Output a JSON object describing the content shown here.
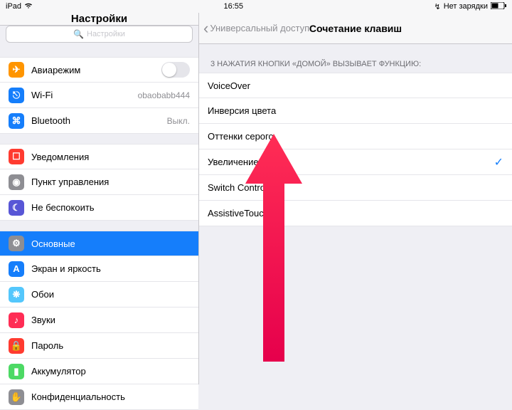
{
  "status": {
    "device": "iPad",
    "time": "16:55",
    "charging": "Нет зарядки"
  },
  "left": {
    "title": "Настройки",
    "search_placeholder": "Настройки",
    "groups": [
      {
        "rows": [
          {
            "id": "airplane",
            "icon_bg": "#ff9500",
            "glyph": "✈",
            "label": "Авиарежим",
            "type": "toggle"
          },
          {
            "id": "wifi",
            "icon_bg": "#157efb",
            "glyph": "⎋",
            "label": "Wi-Fi",
            "detail": "obaobabb444"
          },
          {
            "id": "bluetooth",
            "icon_bg": "#157efb",
            "glyph": "⌘",
            "label": "Bluetooth",
            "detail": "Выкл."
          }
        ]
      },
      {
        "rows": [
          {
            "id": "notifications",
            "icon_bg": "#ff3b30",
            "glyph": "☐",
            "label": "Уведомления"
          },
          {
            "id": "controlcenter",
            "icon_bg": "#8e8e93",
            "glyph": "◉",
            "label": "Пункт управления"
          },
          {
            "id": "dnd",
            "icon_bg": "#5856d6",
            "glyph": "☾",
            "label": "Не беспокоить"
          }
        ]
      },
      {
        "rows": [
          {
            "id": "general",
            "icon_bg": "#8e8e93",
            "glyph": "⚙",
            "label": "Основные",
            "selected": true
          },
          {
            "id": "display",
            "icon_bg": "#157efb",
            "glyph": "A",
            "label": "Экран и яркость"
          },
          {
            "id": "wallpaper",
            "icon_bg": "#54c7fc",
            "glyph": "❋",
            "label": "Обои"
          },
          {
            "id": "sounds",
            "icon_bg": "#ff2d55",
            "glyph": "♪",
            "label": "Звуки"
          },
          {
            "id": "passcode",
            "icon_bg": "#ff3b30",
            "glyph": "🔒",
            "label": "Пароль"
          },
          {
            "id": "battery",
            "icon_bg": "#4cd964",
            "glyph": "▮",
            "label": "Аккумулятор"
          },
          {
            "id": "privacy",
            "icon_bg": "#8e8e93",
            "glyph": "✋",
            "label": "Конфиденциальность"
          }
        ]
      }
    ]
  },
  "right": {
    "back_label": "Универсальный доступ",
    "title": "Сочетание клавиш",
    "group_header": "3 НАЖАТИЯ КНОПКИ «ДОМОЙ» ВЫЗЫВАЕТ ФУНКЦИЮ:",
    "options": [
      {
        "label": "VoiceOver",
        "checked": false
      },
      {
        "label": "Инверсия цвета",
        "checked": false
      },
      {
        "label": "Оттенки серого",
        "checked": false
      },
      {
        "label": "Увеличение",
        "checked": true
      },
      {
        "label": "Switch Control",
        "checked": false
      },
      {
        "label": "AssistiveTouch",
        "checked": false
      }
    ]
  }
}
